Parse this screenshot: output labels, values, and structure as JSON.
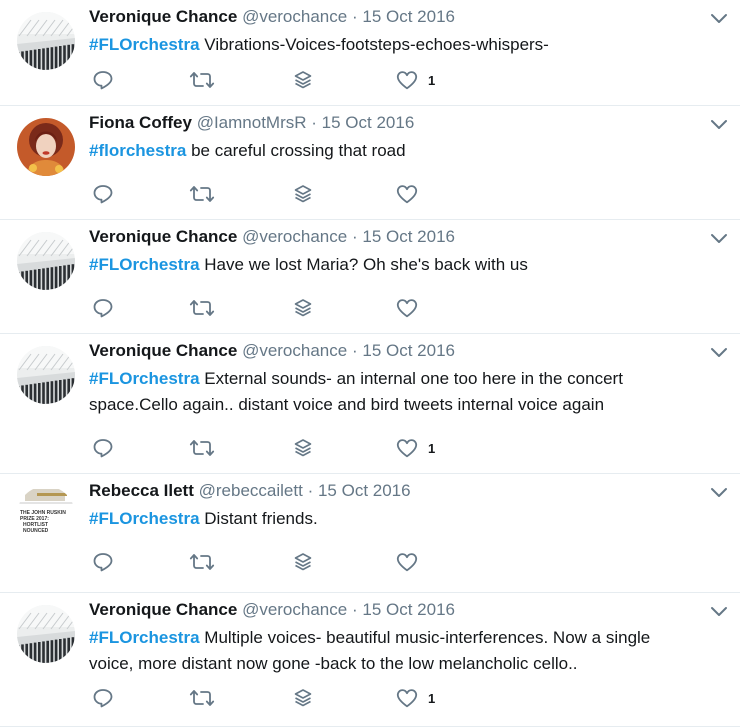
{
  "tweets": [
    {
      "name": "Veronique Chance",
      "handle": "@verochance",
      "sep": "·",
      "date": "15 Oct 2016",
      "hashtag": "#FLOrchestra",
      "text": "Vibrations-Voices-footsteps-echoes-whispers-",
      "likes": "1",
      "avatar": "piano-keys"
    },
    {
      "name": "Fiona Coffey",
      "handle": "@IamnotMrsR",
      "sep": "·",
      "date": "15 Oct 2016",
      "hashtag": "#florchestra",
      "text": "be careful crossing that road",
      "likes": "",
      "avatar": "portrait"
    },
    {
      "name": "Veronique Chance",
      "handle": "@verochance",
      "sep": "·",
      "date": "15 Oct 2016",
      "hashtag": "#FLOrchestra",
      "text": "Have we lost Maria? Oh she's back with us",
      "likes": "",
      "avatar": "piano-keys"
    },
    {
      "name": "Veronique Chance",
      "handle": "@verochance",
      "sep": "·",
      "date": "15 Oct 2016",
      "hashtag": "#FLOrchestra",
      "text": "External sounds- an internal one too here in the concert space.Cello again.. distant voice and bird tweets internal voice again",
      "likes": "1",
      "avatar": "piano-keys"
    },
    {
      "name": "Rebecca Ilett",
      "handle": "@rebeccailett",
      "sep": "·",
      "date": "15 Oct 2016",
      "hashtag": "#FLOrchestra",
      "text": "Distant friends.",
      "likes": "",
      "avatar": "prize-card",
      "avatar_text": [
        "THE JOHN RUSKIN",
        "PRIZE 2017:",
        "HORTLIST",
        "NOUNCED"
      ]
    },
    {
      "name": "Veronique Chance",
      "handle": "@verochance",
      "sep": "·",
      "date": "15 Oct 2016",
      "hashtag": "#FLOrchestra",
      "text": " Multiple voices- beautiful music-interferences. Now a single voice, more distant now gone -back to the low melancholic cello..",
      "likes": "1",
      "avatar": "piano-keys"
    }
  ],
  "icons": {
    "reply": "reply-icon",
    "retweet": "retweet-icon",
    "dm": "stack-icon",
    "like": "heart-icon",
    "menu": "chevron-down-icon"
  },
  "colors": {
    "hashtag": "#1b95e0",
    "icon": "#657786",
    "divider": "#e6ecf0"
  }
}
